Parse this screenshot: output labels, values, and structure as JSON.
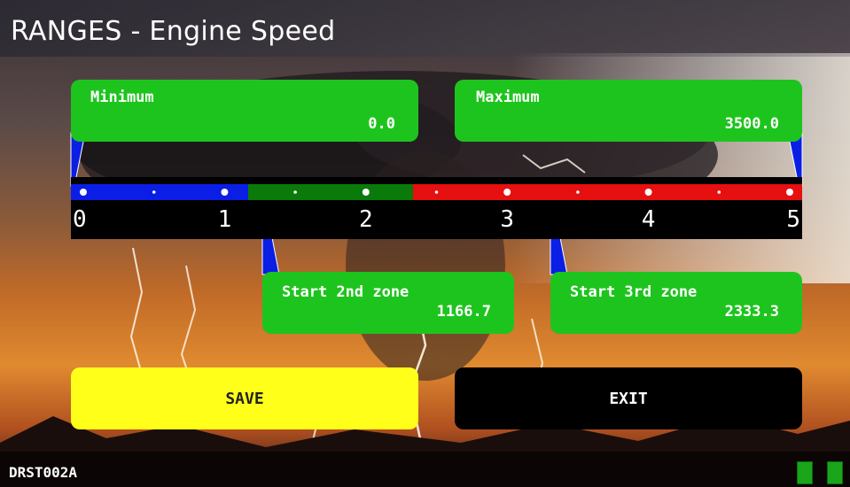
{
  "header": {
    "title": "RANGES - Engine Speed"
  },
  "fields": {
    "minimum": {
      "label": "Minimum",
      "value": "0.0"
    },
    "maximum": {
      "label": "Maximum",
      "value": "3500.0"
    },
    "start_2nd_zone": {
      "label": "Start 2nd zone",
      "value": "1166.7"
    },
    "start_3rd_zone": {
      "label": "Start 3rd zone",
      "value": "2333.3"
    }
  },
  "scale": {
    "ticks": [
      "0",
      "1",
      "2",
      "3",
      "4",
      "5"
    ],
    "zones": [
      {
        "name": "zone-1",
        "color": "#0a1ee6",
        "from": 0.0,
        "to": 1.1667
      },
      {
        "name": "zone-2",
        "color": "#0a7a0a",
        "from": 1.1667,
        "to": 2.3333
      },
      {
        "name": "zone-3",
        "color": "#e61010",
        "from": 2.3333,
        "to": 5.0
      }
    ]
  },
  "buttons": {
    "save": "SAVE",
    "exit": "EXIT"
  },
  "footer": {
    "device_id": "DRST002A",
    "icons": [
      "sd-card-icon",
      "sd-card-icon"
    ]
  },
  "colors": {
    "field_green": "#1ec41e",
    "save_yellow": "#ffff1a",
    "exit_black": "#000000"
  }
}
